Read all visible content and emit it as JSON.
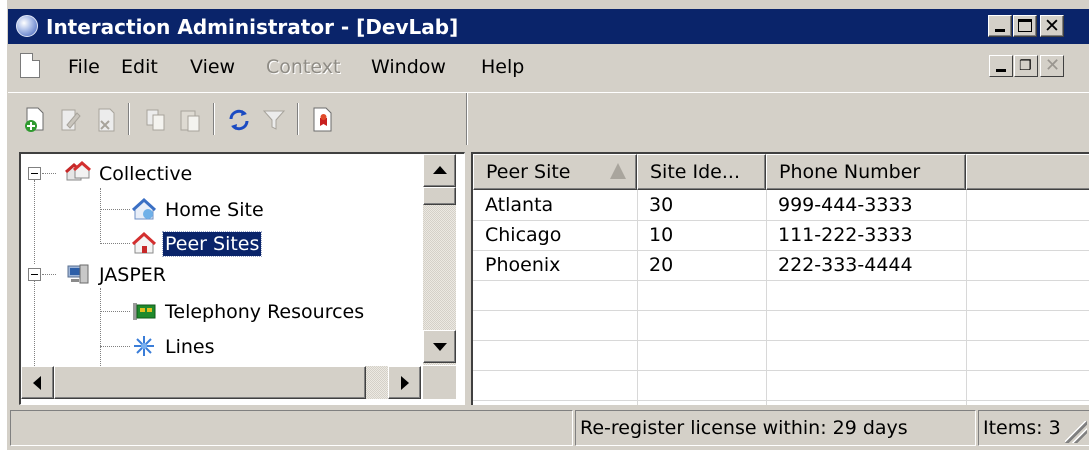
{
  "window": {
    "title": "Interaction Administrator - [DevLab]"
  },
  "menu": {
    "items": [
      {
        "label": "File",
        "enabled": true
      },
      {
        "label": "Edit",
        "enabled": true
      },
      {
        "label": "View",
        "enabled": true
      },
      {
        "label": "Context",
        "enabled": false
      },
      {
        "label": "Window",
        "enabled": true
      },
      {
        "label": "Help",
        "enabled": true
      }
    ]
  },
  "toolbar": {
    "buttons": [
      "new-item-icon",
      "edit-icon",
      "delete-icon",
      "copy-icon",
      "paste-icon",
      "refresh-icon",
      "filter-icon",
      "report-icon"
    ]
  },
  "tree": {
    "nodes": [
      {
        "label": "Collective",
        "icon": "collective-icon",
        "selected": false
      },
      {
        "label": "Home Site",
        "icon": "home-site-icon",
        "selected": false
      },
      {
        "label": "Peer Sites",
        "icon": "peer-sites-icon",
        "selected": true
      },
      {
        "label": "JASPER",
        "icon": "server-icon",
        "selected": false
      },
      {
        "label": "Telephony Resources",
        "icon": "telephony-card-icon",
        "selected": false
      },
      {
        "label": "Lines",
        "icon": "lines-icon",
        "selected": false
      }
    ]
  },
  "list": {
    "columns": [
      "Peer Site",
      "Site Ide...",
      "Phone Number"
    ],
    "sort_column": "Peer Site",
    "rows": [
      [
        "Atlanta",
        "30",
        "999-444-3333"
      ],
      [
        "Chicago",
        "10",
        "111-222-3333"
      ],
      [
        "Phoenix",
        "20",
        "222-333-4444"
      ]
    ]
  },
  "status": {
    "license": "Re-register license within: 29 days",
    "items": "Items: 3"
  },
  "colors": {
    "title_bar": "#0a246a",
    "chrome": "#d4d0c8",
    "selection": "#0a246a"
  }
}
